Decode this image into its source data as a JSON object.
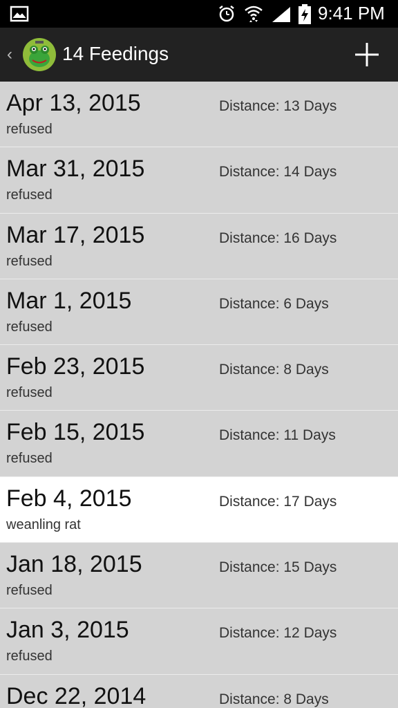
{
  "status_bar": {
    "time": "9:41 PM",
    "icons": [
      "gallery-icon",
      "alarm-icon",
      "wifi-icon",
      "signal-icon",
      "battery-charging-icon"
    ]
  },
  "action_bar": {
    "title": "14 Feedings",
    "back_icon": "chevron-left-icon",
    "app_icon": "frog-avatar-icon",
    "add_icon": "plus-icon"
  },
  "feedings": [
    {
      "date": "Apr 13, 2015",
      "note": "refused",
      "distance": "Distance: 13 Days",
      "selected": false
    },
    {
      "date": "Mar 31, 2015",
      "note": "refused",
      "distance": "Distance: 14 Days",
      "selected": false
    },
    {
      "date": "Mar 17, 2015",
      "note": "refused",
      "distance": "Distance: 16 Days",
      "selected": false
    },
    {
      "date": "Mar 1, 2015",
      "note": "refused",
      "distance": "Distance: 6 Days",
      "selected": false
    },
    {
      "date": "Feb 23, 2015",
      "note": "refused",
      "distance": "Distance: 8 Days",
      "selected": false
    },
    {
      "date": "Feb 15, 2015",
      "note": "refused",
      "distance": "Distance: 11 Days",
      "selected": false
    },
    {
      "date": "Feb 4, 2015",
      "note": "weanling rat",
      "distance": "Distance: 17 Days",
      "selected": true
    },
    {
      "date": "Jan 18, 2015",
      "note": "refused",
      "distance": "Distance: 15 Days",
      "selected": false
    },
    {
      "date": "Jan 3, 2015",
      "note": "refused",
      "distance": "Distance: 12 Days",
      "selected": false
    },
    {
      "date": "Dec 22, 2014",
      "note": "",
      "distance": "Distance: 8 Days",
      "selected": false
    }
  ],
  "colors": {
    "list_background": "#d3d3d3",
    "selected_background": "#ffffff",
    "action_bar": "#222222",
    "status_bar": "#000000"
  }
}
